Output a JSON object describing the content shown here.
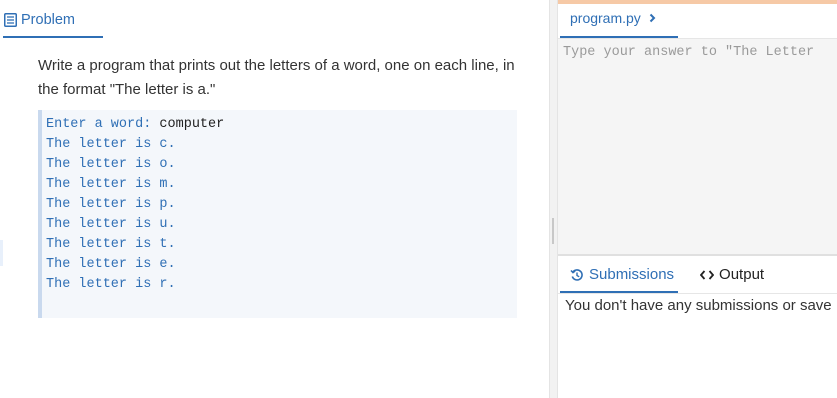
{
  "problem_tab": {
    "label": "Problem",
    "icon": "document-icon"
  },
  "problem": {
    "description": "Write a program that prints out the letters of a word, one on each line, in the format \"The letter is a.\""
  },
  "sample": {
    "prompt": "Enter a word: ",
    "input": "computer",
    "output_lines": [
      "The letter is c.",
      "The letter is o.",
      "The letter is m.",
      "The letter is p.",
      "The letter is u.",
      "The letter is t.",
      "The letter is e.",
      "The letter is r."
    ]
  },
  "editor": {
    "filename": "program.py",
    "placeholder": "Type your answer to \"The Letter"
  },
  "bottom_tabs": {
    "submissions_label": "Submissions",
    "output_label": "Output",
    "submissions_message": "You don't have any submissions or save"
  },
  "colors": {
    "accent": "#2f6fb5",
    "top_accent": "#f6c9a6"
  }
}
